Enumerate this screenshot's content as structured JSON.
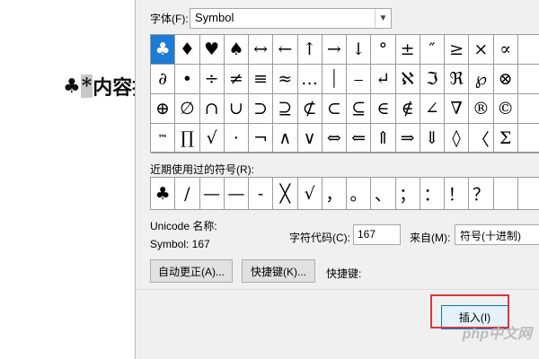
{
  "document": {
    "prefix_symbol": "♣",
    "selected_char": "*",
    "text": "内容提"
  },
  "dialog": {
    "font_label": "字体(F):",
    "font_value": "Symbol",
    "symbols": [
      [
        "♣",
        "♦",
        "♥",
        "♠",
        "↔",
        "←",
        "↑",
        "→",
        "↓",
        "°",
        "±",
        "″",
        "≥",
        "×",
        "∝"
      ],
      [
        "∂",
        "•",
        "÷",
        "≠",
        "≡",
        "≈",
        "…",
        "⏐",
        "⎯",
        "↵",
        "ℵ",
        "ℑ",
        "ℜ",
        "℘",
        "⊗"
      ],
      [
        "⊕",
        "∅",
        "∩",
        "∪",
        "⊃",
        "⊇",
        "⊄",
        "⊂",
        "⊆",
        "∈",
        "∉",
        "∠",
        "∇",
        "®",
        "©"
      ],
      [
        "™",
        "∏",
        "√",
        "⋅",
        "¬",
        "∧",
        "∨",
        "⇔",
        "⇐",
        "⇑",
        "⇒",
        "⇓",
        "◊",
        "〈",
        "Σ"
      ]
    ],
    "recent_label": "近期使用过的符号(R):",
    "recent_symbols": [
      "♣",
      "/",
      "—",
      "—",
      "-",
      "╳",
      "√",
      "，",
      "。",
      "、",
      "；",
      "：",
      "！",
      "？"
    ],
    "unicode_name_label": "Unicode 名称:",
    "symbol_code_text": "Symbol: 167",
    "char_code_label": "字符代码(C):",
    "char_code_value": "167",
    "from_label": "来自(M):",
    "from_value": "符号(十进制)",
    "autocorrect_label": "自动更正(A)...",
    "shortcut_button_label": "快捷键(K)...",
    "shortcut_key_label": "快捷键:",
    "insert_label": "插入(I)"
  },
  "watermark": "php中文网",
  "colors": {
    "selection_blue": "#1e7bd6",
    "highlight_red": "#d9363e"
  }
}
